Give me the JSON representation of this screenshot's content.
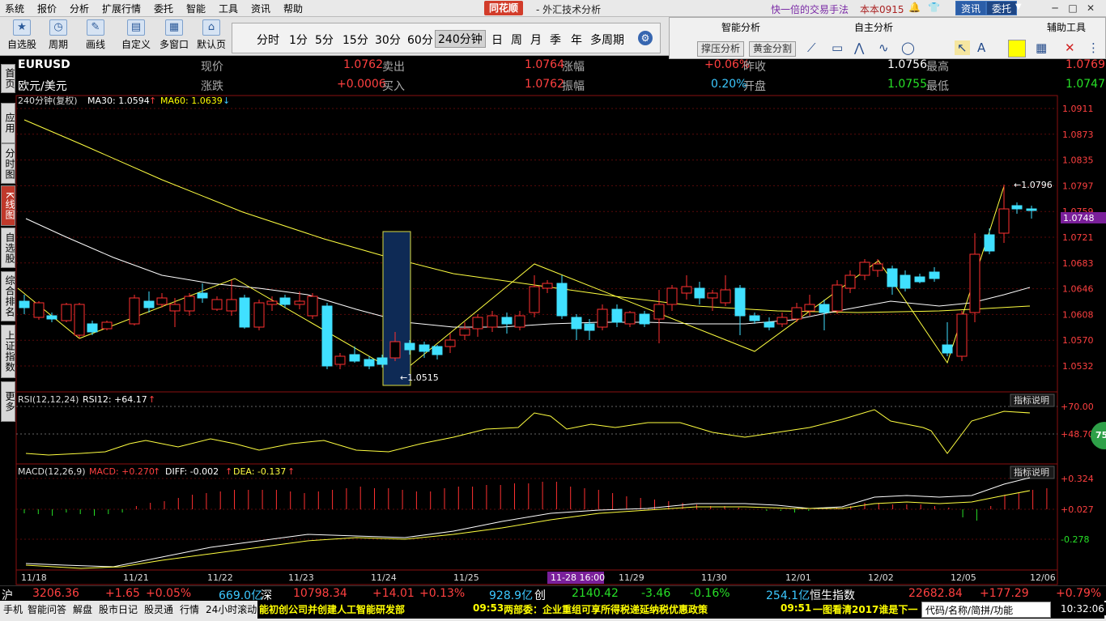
{
  "menu": [
    "系统",
    "报价",
    "分析",
    "扩展行情",
    "委托",
    "智能",
    "工具",
    "资讯",
    "帮助"
  ],
  "logo": "同花顺",
  "app_title": "- 外汇技术分析",
  "promo": "快一倍的交易手法",
  "version": "本本0915",
  "btn_news": "资讯",
  "btn_entrust": "委托",
  "toolbar": [
    "自选股",
    "周期",
    "画线",
    "自定义",
    "多窗口",
    "默认页"
  ],
  "periods": [
    "分时",
    "1分",
    "5分",
    "15分",
    "30分",
    "60分",
    "240分钟",
    "日",
    "周",
    "月",
    "季",
    "年",
    "多周期"
  ],
  "right_panel": {
    "smart": "智能分析",
    "self": "自主分析",
    "aux": "辅助工具",
    "support": "撑压分析",
    "golden": "黄金分割"
  },
  "leftnav": [
    "首页",
    "应用",
    "分时图",
    "K线图",
    "自选股",
    "综合排名",
    "上证指数",
    "更多"
  ],
  "quote": {
    "symbol": "EURUSD",
    "name": "欧元/美元",
    "l_now": "现价",
    "now": "1.0762",
    "l_sell": "卖出",
    "sell": "1.0764",
    "l_rise": "涨幅",
    "rise": "+0.06%",
    "l_prev": "昨收",
    "prev": "1.0756",
    "l_high": "最高",
    "high": "1.0769",
    "l_chg": "涨跌",
    "chg": "+0.0006",
    "l_buy": "买入",
    "buy": "1.0762",
    "l_amp": "振幅",
    "amp": "0.20%",
    "l_open": "开盘",
    "open": "1.0755",
    "l_low": "最低",
    "low": "1.0747"
  },
  "ma_line": {
    "period": "240分钟(复权)",
    "ma30": "MA30: 1.0594",
    "ma60": "MA60: 1.0639"
  },
  "rsi_label": {
    "title": "RSI(12,12,24)",
    "value": "RSI12: +64.17"
  },
  "macd_label": {
    "title": "MACD(12,26,9)",
    "macd": "MACD: +0.270",
    "diff": "DIFF: -0.002",
    "dea": "DEA: -0.137"
  },
  "indicator_btn": "指标说明",
  "badge": "75",
  "status1": {
    "sh": "沪",
    "sh_v": "3206.36",
    "sh_c": "+1.65",
    "sh_p": "+0.05%",
    "sh_a": "669.0亿",
    "sz": "深",
    "sz_v": "10798.34",
    "sz_c": "+14.01",
    "sz_p": "+0.13%",
    "sz_a": "928.9亿",
    "cy": "创",
    "cy_v": "2140.42",
    "cy_c": "-3.46",
    "cy_p": "-0.16%",
    "cy_a": "254.1亿",
    "hs": "恒生指数",
    "hs_v": "22682.84",
    "hs_c": "+177.29",
    "hs_p": "+0.79%"
  },
  "status2": {
    "tabs": [
      "手机",
      "智能问答",
      "解盘",
      "股市日记",
      "股灵通",
      "行情",
      "24小时滚动"
    ],
    "news1": "能初创公司并创建人工智能研发部",
    "news2_time": "09:53",
    "news2": "两部委：企业重组可享所得税递延纳税优惠政策",
    "news3_time": "09:51",
    "news3": "一图看清2017谁是下一",
    "search": "代码/名称/简拼/功能",
    "clock": "10:32:06"
  },
  "chart_data": {
    "type": "candlestick",
    "price_axis": {
      "min": 1.0515,
      "max": 1.0911,
      "ticks": [
        "1.0911",
        "1.0873",
        "1.0835",
        "1.0797",
        "1.0759",
        "1.0721",
        "1.0683",
        "1.0646",
        "1.0608",
        "1.0570",
        "1.0532"
      ]
    },
    "current_price": "1.0748",
    "high_mark": "1.0796",
    "low_mark": "1.0515",
    "dates": [
      "11/18",
      "11/21",
      "11/22",
      "11/23",
      "11/24",
      "11/25",
      "11/28",
      "11/29",
      "11/30",
      "12/01",
      "12/02",
      "12/05",
      "12/06"
    ],
    "crosshair_date": "11-28 16:00",
    "rsi_axis": {
      "ticks": [
        "+70.00",
        "+48.70"
      ]
    },
    "macd_axis": {
      "ticks": [
        "+0.324",
        "+0.027",
        "-0.278"
      ]
    }
  }
}
